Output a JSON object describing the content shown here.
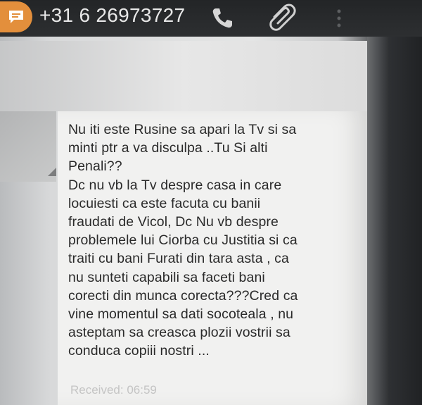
{
  "header": {
    "contact_icon": "message-icon",
    "phone_number": "+31 6 26973727",
    "call_icon": "phone-icon",
    "attach_icon": "paperclip-icon",
    "menu_icon": "overflow-menu-icon"
  },
  "message": {
    "body": "Nu iti este Rusine sa apari la Tv si sa\nminti ptr a va disculpa ..Tu Si alti\nPenali??\nDc nu vb la Tv despre casa in care\nlocuiesti ca este facuta cu banii\nfraudati de Vicol, Dc  Nu vb despre\nproblemele lui Ciorba cu Justitia si ca\ntraiti cu bani Furati din tara asta , ca\nnu sunteti capabili sa faceti bani\ncorecti din munca corecta???Cred ca\nvine momentul sa dati socoteala , nu\nasteptam sa creasca plozii vostrii sa\nconduca copiii nostri ...",
    "received_label": "Received: 06:59"
  },
  "colors": {
    "avatar_accent": "#e38f3c",
    "header_bg": "#2a2c2f",
    "bubble_bg": "#f1f1f0",
    "text": "#2a2a2a",
    "timestamp": "#c4c4c4"
  }
}
